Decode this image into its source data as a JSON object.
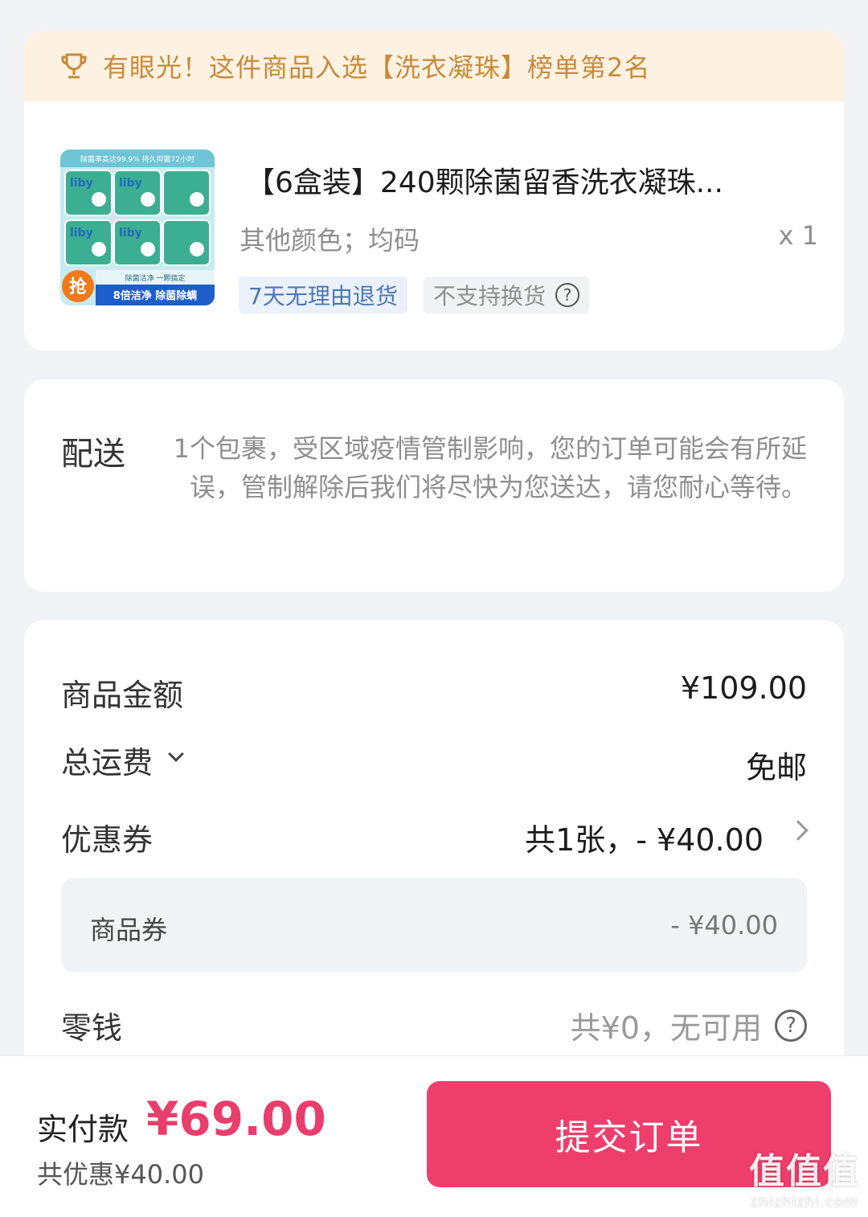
{
  "rank_banner": {
    "text": "有眼光！这件商品入选【洗衣凝珠】榜单第2名"
  },
  "product": {
    "image_texts": [
      "除菌率高达99.9% 持久抑菌72小时",
      "liby",
      "抢",
      "除菌洁净 一颗搞定",
      "8倍洁净 除菌除螨"
    ],
    "title": "【6盒装】240颗除菌留香洗衣凝珠...",
    "spec": "其他颜色；均码",
    "quantity": "x 1",
    "tag_return": "7天无理由退货",
    "tag_exchange": "不支持换货"
  },
  "delivery": {
    "label": "配送",
    "text": "1个包裹，受区域疫情管制影响，您的订单可能会有所延误，管制解除后我们将尽快为您送达，请您耐心等待。"
  },
  "price": {
    "goods_amount_label": "商品金额",
    "goods_amount": "¥109.00",
    "shipping_label": "总运费",
    "shipping_value": "免邮",
    "coupon_label": "优惠券",
    "coupon_value": "共1张，- ¥40.00",
    "goods_coupon_label": "商品券",
    "goods_coupon_value": "- ¥40.00",
    "change_label": "零钱",
    "change_value": "共¥0，无可用"
  },
  "footer": {
    "pay_label": "实付款",
    "pay_amount": "¥69.00",
    "saved": "共优惠¥40.00",
    "submit": "提交订单"
  },
  "watermark": {
    "logo": "值值值",
    "url": "zhizhizhi.com"
  },
  "colors": {
    "accent": "#ee3e6c",
    "banner_bg": "#fdf1e2",
    "banner_text": "#c88a3a"
  }
}
